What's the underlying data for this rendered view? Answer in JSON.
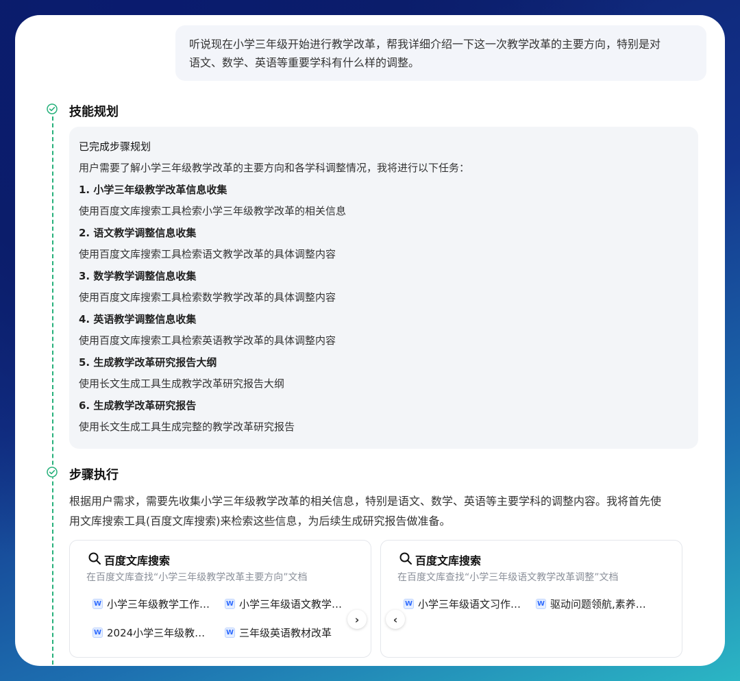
{
  "user_message": {
    "line1": "听说现在小学三年级开始进行教学改革，帮我详细介绍一下这一次教学改革的主要方向，特别是对",
    "line2": "语文、数学、英语等重要学科有什么样的调整。"
  },
  "skill_plan": {
    "title": "技能规划",
    "status": "已完成步骤规划",
    "intro": "用户需要了解小学三年级教学改革的主要方向和各学科调整情况，我将进行以下任务：",
    "steps": [
      {
        "title": "1. 小学三年级教学改革信息收集",
        "desc": "使用百度文库搜索工具检索小学三年级教学改革的相关信息"
      },
      {
        "title": "2. 语文教学调整信息收集",
        "desc": "使用百度文库搜索工具检索语文教学改革的具体调整内容"
      },
      {
        "title": "3. 数学教学调整信息收集",
        "desc": "使用百度文库搜索工具检索数学教学改革的具体调整内容"
      },
      {
        "title": "4. 英语教学调整信息收集",
        "desc": "使用百度文库搜索工具检索英语教学改革的具体调整内容"
      },
      {
        "title": "5. 生成教学改革研究报告大纲",
        "desc": "使用长文生成工具生成教学改革研究报告大纲"
      },
      {
        "title": "6. 生成教学改革研究报告",
        "desc": "使用长文生成工具生成完整的教学改革研究报告"
      }
    ]
  },
  "step_exec": {
    "title": "步骤执行",
    "line1": "根据用户需求，需要先收集小学三年级教学改革的相关信息，特别是语文、数学、英语等主要学科的调整内容。我将首先使",
    "line2": "用文库搜索工具(百度文库搜索)来检索这些信息，为后续生成研究报告做准备。"
  },
  "search_cards": [
    {
      "title": "百度文库搜索",
      "subtitle": "在百度文库查找“小学三年级教学改革主要方向”文档",
      "docs": [
        "小学三年级教学工作…",
        "小学三年级语文教学…",
        "2024小学三年级教…",
        "三年级英语教材改革"
      ]
    },
    {
      "title": "百度文库搜索",
      "subtitle": "在百度文库查找“小学三年级语文教学改革调整”文档",
      "docs": [
        "小学三年级语文习作…",
        "驱动问题领航,素养…"
      ]
    }
  ],
  "icons": {
    "doc_badge": "W",
    "next": "›",
    "prev": "‹"
  },
  "colors": {
    "accent_green": "#25b07a",
    "doc_blue": "#2f6bff"
  }
}
